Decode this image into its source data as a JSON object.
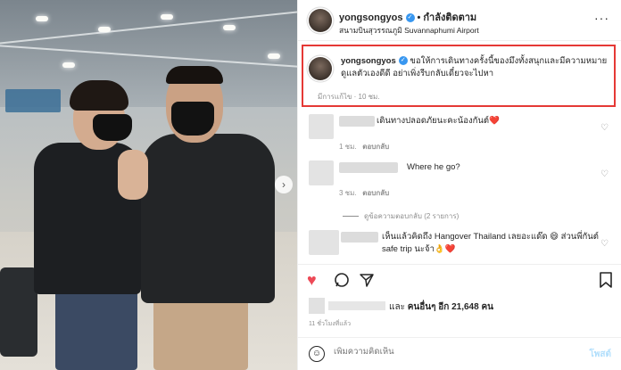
{
  "header": {
    "username": "yongsongyos",
    "dot": "•",
    "follow_label": "กำลังติดตาม",
    "location": "สนามบินสุวรรณภูมิ Suvannaphumi Airport",
    "more_label": "···"
  },
  "caption": {
    "username": "yongsongyos",
    "text": "ขอให้การเดินทางครั้งนี้ของมึงทั้งสนุกและมีความหมาย ดูแลตัวเองดีดี อย่าเพิ่งรีบกลับเดี๋ยวจะไปหา",
    "meta": "มีการแก้ไข · 10 ชม."
  },
  "comments": [
    {
      "text": "เดินทางปลอดภัยนะคะน้องกันต์❤️",
      "time": "1 ชม.",
      "reply": "ตอบกลับ"
    },
    {
      "text": "Where he go?",
      "time": "3 ชม.",
      "reply": "ตอบกลับ"
    },
    {
      "text": "เห็นแล้วคิดถึง Hangover Thailand เลยอะแด๊ด 😄 ส่วนพี่กันต์ safe trip นะจ้า👌❤️",
      "time": "",
      "reply": ""
    }
  ],
  "view_replies": "ดูข้อความตอบกลับ (2 รายการ)",
  "actions": {
    "like_icon": "heart-icon",
    "comment_icon": "comment-icon",
    "share_icon": "share-icon",
    "save_icon": "bookmark-icon"
  },
  "likes": {
    "text_prefix": "และ",
    "text_strong": "คนอื่นๆ อีก 21,648 คน"
  },
  "time_ago": "11 ชั่วโมงที่แล้ว",
  "comment_input": {
    "placeholder": "เพิ่มความคิดเห็น",
    "post_label": "โพสต์"
  },
  "colors": {
    "accent": "#3897f0",
    "like_red": "#ed4956",
    "highlight_border": "#e53935"
  }
}
